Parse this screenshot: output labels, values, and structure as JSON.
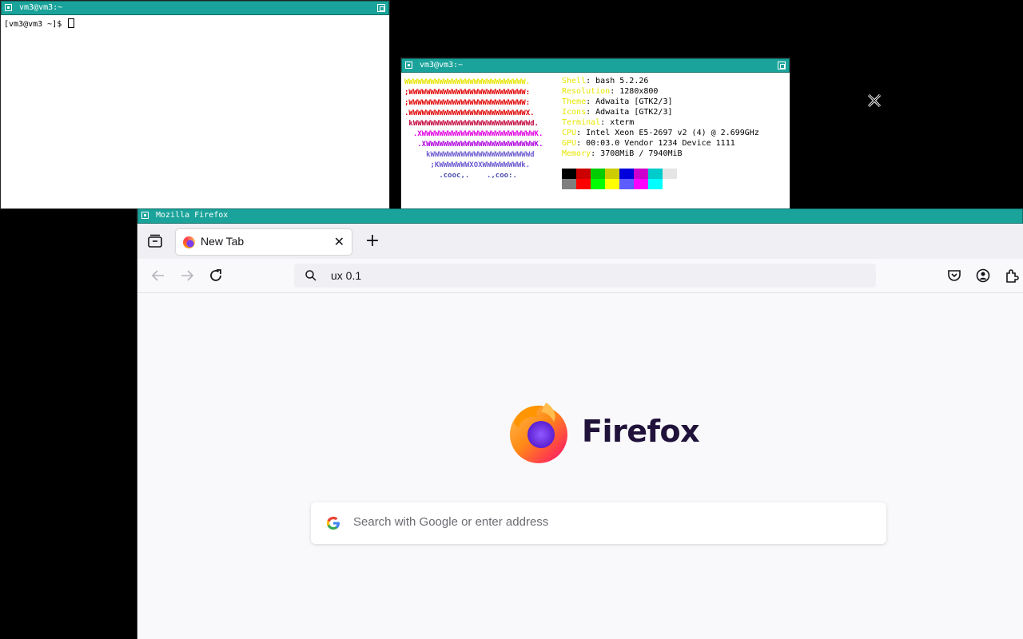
{
  "terminal1": {
    "title": "vm3@vm3:~",
    "prompt": "[vm3@vm3 ~]$ "
  },
  "terminal2": {
    "title": "vm3@vm3:~",
    "logo_lines": [
      {
        "text": "WWWWWWWWWWWWWWWWWWWWWWWWWWWW.",
        "color": "#e6e600"
      },
      {
        "text": ";WWWWWWWWWWWWWWWWWWWWWWWWWWW:",
        "color": "#e00000"
      },
      {
        "text": ";WWWWWWWWWWWWWWWWWWWWWWWWWWW:",
        "color": "#e00000"
      },
      {
        "text": ".WWWWWWWWWWWWWWWWWWWWWWWWWWWX.",
        "color": "#e00000"
      },
      {
        "text": " kWWWWWWWWWWWWWWWWWWWWWWWWWWWd.",
        "color": "#c0003a"
      },
      {
        "text": "  .XWWWWWWWWWWWWWWWWWWWWWWWWWWK.",
        "color": "#e000e0"
      },
      {
        "text": "   .XWWWWWWWWWWWWWWWWWWWWWWWWWK.",
        "color": "#b000e0"
      },
      {
        "text": "     kWWWWWWWWWWWWWWWWWWWWWWWd",
        "color": "#6a5ad0"
      },
      {
        "text": "      ;KWWWWWWWXOXWWWWWWWWWk.",
        "color": "#6a5ad0"
      },
      {
        "text": "        .cooc,.    .,coo:.",
        "color": "#4a4ab0"
      }
    ],
    "info": [
      {
        "key": "Shell",
        "value": "bash 5.2.26"
      },
      {
        "key": "Resolution",
        "value": "1280x800"
      },
      {
        "key": "Theme",
        "value": "Adwaita [GTK2/3]"
      },
      {
        "key": "Icons",
        "value": "Adwaita [GTK2/3]"
      },
      {
        "key": "Terminal",
        "value": "xterm"
      },
      {
        "key": "CPU",
        "value": "Intel Xeon E5-2697 v2 (4) @ 2.699GHz"
      },
      {
        "key": "GPU",
        "value": "00:03.0 Vendor 1234 Device 1111"
      },
      {
        "key": "Memory",
        "value": "3708MiB / 7940MiB"
      }
    ],
    "palette_top": [
      "#000000",
      "#cc0000",
      "#00cc00",
      "#cccc00",
      "#0000dd",
      "#cc00cc",
      "#00cccc",
      "#e5e5e5"
    ],
    "palette_bottom": [
      "#7f7f7f",
      "#ff0000",
      "#00ff00",
      "#ffff00",
      "#5c5cff",
      "#ff00ff",
      "#00ffff",
      "#ffffff"
    ]
  },
  "firefox": {
    "window_title": "Mozilla Firefox",
    "tab_label": "New Tab",
    "url_text": "ux 0.1",
    "brand_word": "Firefox",
    "search_placeholder": "Search with Google or enter address"
  }
}
